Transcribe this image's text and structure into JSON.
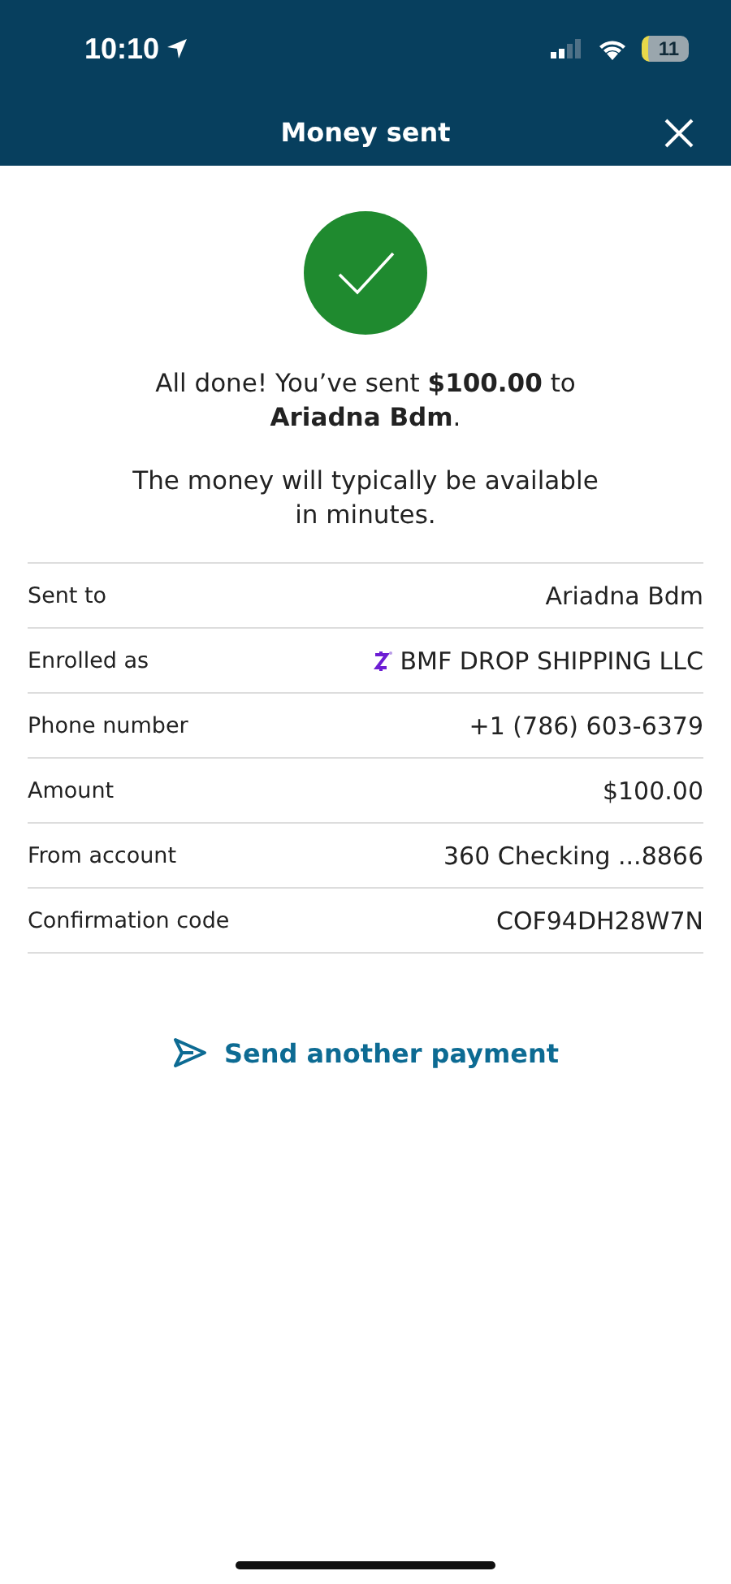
{
  "status_bar": {
    "time": "10:10",
    "battery": "11"
  },
  "header": {
    "title": "Money sent"
  },
  "message": "All done! You’ve sent **$100.00** to **Ariadna Bdm**.",
  "note": "The money will typically be available in minutes.",
  "details": [
    {
      "label": "Sent to",
      "value": "Ariadna Bdm",
      "kind": "text"
    },
    {
      "label": "Enrolled as",
      "value": "BMF DROP SHIPPING LLC",
      "kind": "zelle"
    },
    {
      "label": "Phone number",
      "value": "+1 (786) 603-6379",
      "kind": "text"
    },
    {
      "label": "Amount",
      "value": "$100.00",
      "kind": "text"
    },
    {
      "label": "From account",
      "value": "360 Checking ...8866",
      "kind": "text"
    },
    {
      "label": "Confirmation code",
      "value": "COF94DH28W7N",
      "kind": "text"
    }
  ],
  "action": {
    "label": "Send another payment"
  }
}
